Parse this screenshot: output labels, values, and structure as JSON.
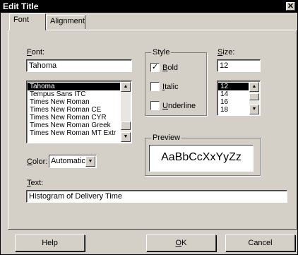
{
  "window": {
    "title": "Edit Title",
    "close_glyph": "✕"
  },
  "tabs": [
    {
      "label": "Font"
    },
    {
      "label": "Alignment"
    }
  ],
  "font": {
    "label_first": "F",
    "label_rest": "ont:",
    "value": "Tahoma",
    "items": [
      "Tahoma",
      "Tempus Sans ITC",
      "Times New Roman",
      "Times New Roman CE",
      "Times New Roman CYR",
      "Times New Roman Greek",
      "Times New Roman MT Extr"
    ],
    "selected": "Tahoma"
  },
  "style": {
    "group_label": "Style",
    "bold": {
      "first": "B",
      "rest": "old",
      "checked": true,
      "mark": "✓"
    },
    "italic": {
      "first": "I",
      "rest": "talic",
      "checked": false
    },
    "underline": {
      "first": "U",
      "rest": "nderline",
      "checked": false
    }
  },
  "size": {
    "label_first": "S",
    "label_rest": "ize:",
    "value": "12",
    "items": [
      "12",
      "14",
      "16",
      "18"
    ],
    "selected": "12"
  },
  "color": {
    "label_first": "C",
    "label_rest": "olor:",
    "value": "Automatic"
  },
  "preview": {
    "group_label": "Preview",
    "sample": "AaBbCcXxYyZz"
  },
  "text": {
    "label_first": "T",
    "label_rest": "ext:",
    "value": "Histogram of Delivery Time"
  },
  "buttons": {
    "help": "Help",
    "ok_first": "O",
    "ok_rest": "K",
    "cancel": "Cancel"
  },
  "icons": {
    "arrow_up": "▲",
    "arrow_down": "▼"
  }
}
